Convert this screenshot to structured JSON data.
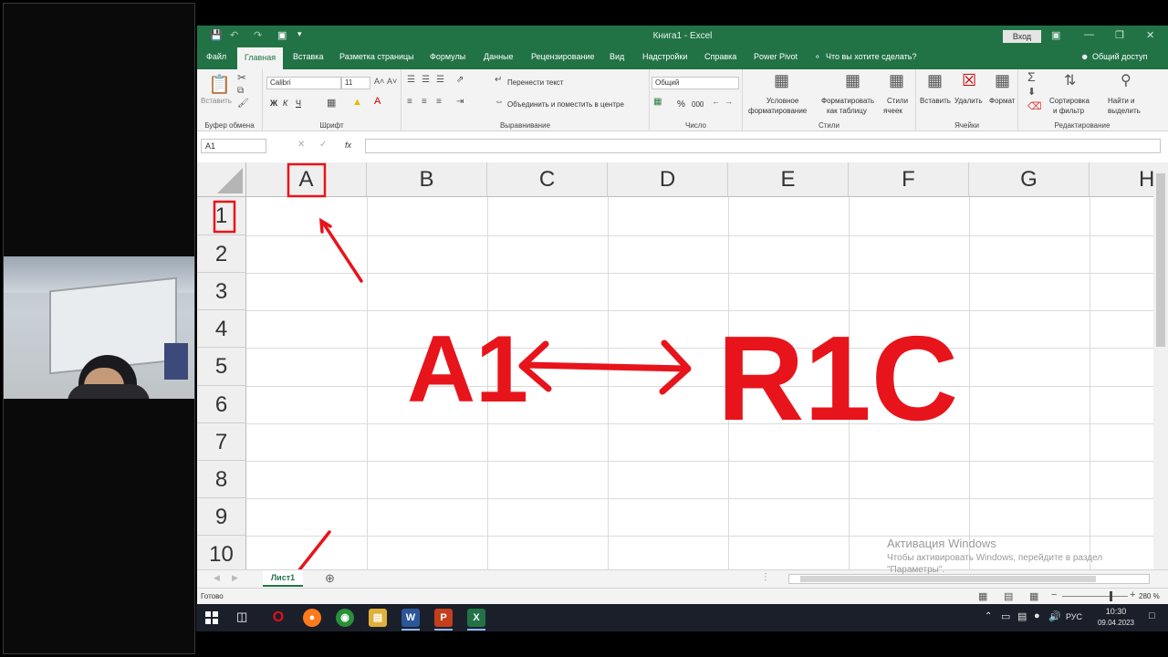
{
  "window": {
    "title": "Книга1  -  Excel",
    "signin": "Вход"
  },
  "tabs": [
    "Файл",
    "Главная",
    "Вставка",
    "Разметка страницы",
    "Формулы",
    "Данные",
    "Рецензирование",
    "Вид",
    "Надстройки",
    "Справка",
    "Power Pivot"
  ],
  "tellme": "Что вы хотите сделать?",
  "share": "Общий доступ",
  "ribbon": {
    "clipboard": {
      "paste": "Вставить",
      "label": "Буфер обмена"
    },
    "font": {
      "name": "Calibri",
      "size": "11",
      "bold": "Ж",
      "italic": "К",
      "underline": "Ч",
      "label": "Шрифт"
    },
    "alignment": {
      "wrap": "Перенести текст",
      "merge": "Объединить и поместить в центре",
      "label": "Выравнивание"
    },
    "number": {
      "format": "Общий",
      "percent": "%",
      "thousands": "000",
      "label": "Число"
    },
    "styles": {
      "conditional": "Условное",
      "conditional2": "форматирование",
      "astable": "Форматировать",
      "astable2": "как таблицу",
      "cellstyles": "Стили",
      "cellstyles2": "ячеек",
      "label": "Стили"
    },
    "cells": {
      "insert": "Вставить",
      "delete": "Удалить",
      "format": "Формат",
      "label": "Ячейки"
    },
    "editing": {
      "sortfilter": "Сортировка",
      "sortfilter2": "и фильтр",
      "find": "Найти и",
      "find2": "выделить",
      "label": "Редактирование"
    }
  },
  "namebox": "A1",
  "fx": "fx",
  "columns": [
    "A",
    "B",
    "C",
    "D",
    "E",
    "F",
    "G",
    "H"
  ],
  "rows": [
    "1",
    "2",
    "3",
    "4",
    "5",
    "6",
    "7",
    "8",
    "9",
    "10"
  ],
  "annotation": {
    "left": "A1",
    "right": "R1C"
  },
  "sheet": {
    "name": "Лист1"
  },
  "status": {
    "ready": "Готово",
    "zoom": "280 %"
  },
  "watermark": {
    "line1": "Активация Windows",
    "line2": "Чтобы активировать Windows, перейдите в раздел",
    "line3": "\"Параметры\"."
  },
  "taskbar": {
    "lang": "РУС",
    "time": "10:30",
    "date": "09.04.2023"
  },
  "colors": {
    "excel_green": "#217346",
    "annotation_red": "#e8141b",
    "taskbar": "#1b1f2a"
  }
}
